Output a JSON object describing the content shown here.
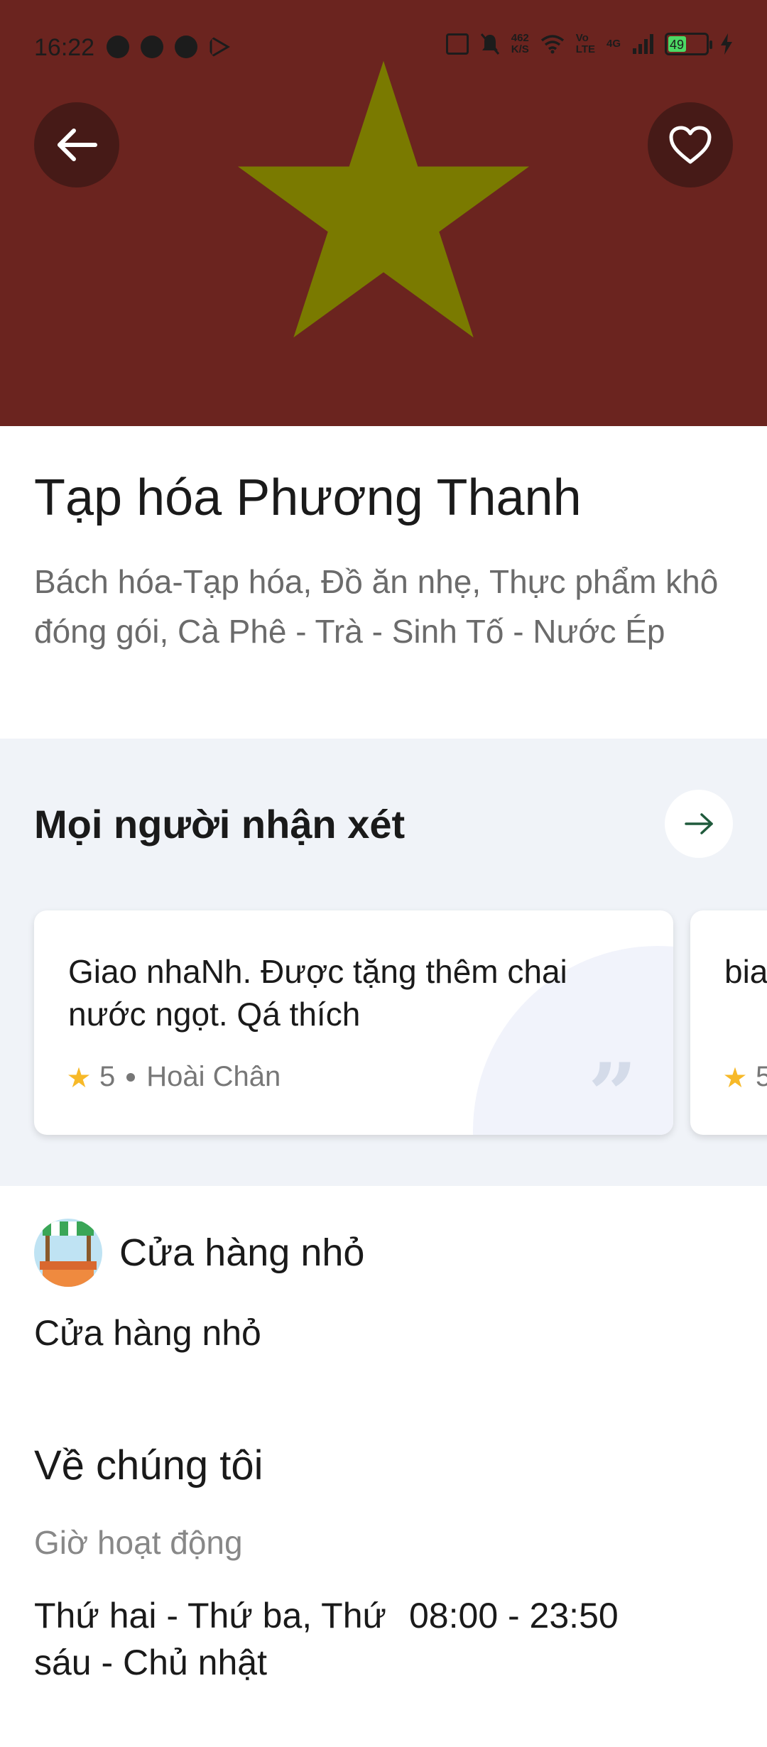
{
  "status_bar": {
    "time": "16:22",
    "net_speed_value": "462",
    "net_speed_unit": "K/S",
    "volte_top": "Vo",
    "volte_bottom": "LTE",
    "network": "4G",
    "battery": "49"
  },
  "header": {
    "banner_color": "#6b241f",
    "star_color": "#7a7a00",
    "back_icon": "arrow-left-icon",
    "favorite_icon": "heart-outline-icon"
  },
  "store": {
    "name": "Tạp hóa Phương Thanh",
    "categories": "Bách hóa-Tạp hóa, Đồ ăn nhẹ, Thực phẩm khô đóng gói, Cà Phê - Trà - Sinh Tố - Nước Ép"
  },
  "reviews": {
    "title": "Mọi người nhận xét",
    "items": [
      {
        "text": "Giao nhaNh. Được tặng thêm chai nước ngọt. Qá thích",
        "rating": "5",
        "author": "Hoài Chân"
      },
      {
        "text": "bia",
        "rating": "5",
        "author": ""
      }
    ]
  },
  "store_type": {
    "label": "Cửa hàng nhỏ",
    "description": "Cửa hàng nhỏ"
  },
  "about": {
    "title": "Về chúng tôi",
    "hours_label": "Giờ hoạt động",
    "hours": [
      {
        "days": "Thứ hai - Thứ ba, Thứ sáu - Chủ nhật",
        "time": "08:00 - 23:50"
      }
    ]
  }
}
